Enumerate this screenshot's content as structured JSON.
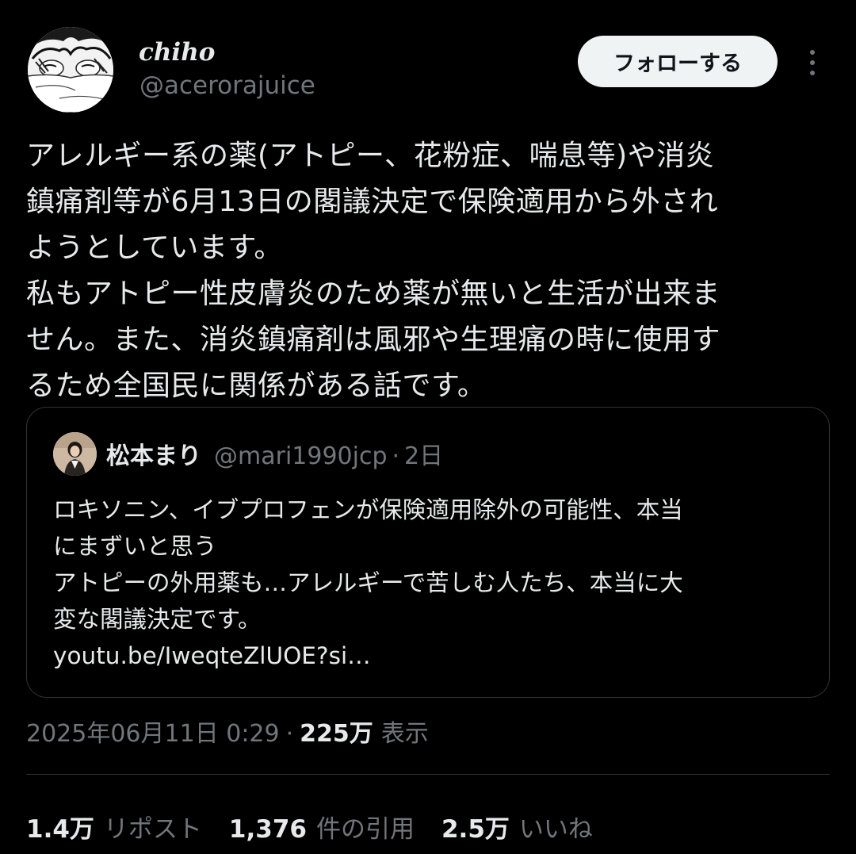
{
  "author": {
    "display_name": "chiho",
    "handle": "@acerorajuice"
  },
  "header": {
    "follow_label": "フォローする",
    "more_icon": "more-vertical-icon"
  },
  "tweet": {
    "text": "アレルギー系の薬(アトピー、花粉症、喘息等)や消炎\n鎮痛剤等が6月13日の閣議決定で保険適用から外され\nようとしています。\n私もアトピー性皮膚炎のため薬が無いと生活が出来ま\nせん。また、消炎鎮痛剤は風邪や生理痛の時に使用す\nるため全国民に関係がある話です。"
  },
  "quote": {
    "name": "松本まり",
    "handle": "@mari1990jcp",
    "separator": "·",
    "time": "2日",
    "text": "ロキソニン、イブプロフェンが保険適用除外の可能性、本当\nにまずいと思う\nアトピーの外用薬も…アレルギーで苦しむ人たち、本当に大\n変な閣議決定です。\nyoutu.be/IweqteZlUOE?si…"
  },
  "meta": {
    "timestamp": "2025年06月11日 0:29",
    "separator": "·",
    "views_count": "225万",
    "views_label": "表示"
  },
  "stats": [
    {
      "num": "1.4万",
      "label": "リポスト"
    },
    {
      "num": "1,376",
      "label": "件の引用"
    },
    {
      "num": "2.5万",
      "label": "いいね"
    }
  ],
  "colors": {
    "background": "#000000",
    "text_primary": "#e7e9ea",
    "text_secondary": "#71767b",
    "border": "#2f3336",
    "button_bg": "#eff3f4"
  }
}
